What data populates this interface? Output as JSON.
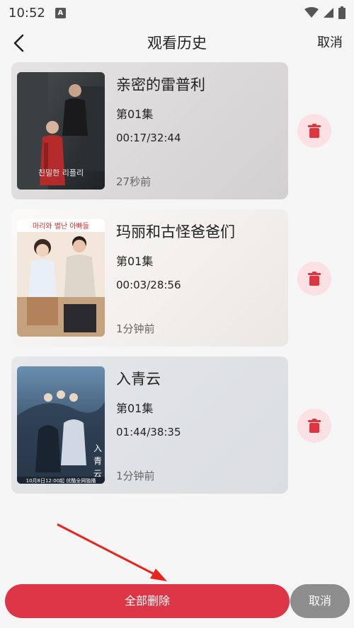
{
  "status_bar": {
    "time": "10:52",
    "notification_letter": "A",
    "icons": [
      "wifi-icon",
      "signal-icon",
      "battery-icon"
    ]
  },
  "header": {
    "title": "观看历史",
    "cancel_label": "取消",
    "back_icon": "chevron-left-icon"
  },
  "history": [
    {
      "title": "亲密的雷普利",
      "episode": "第01集",
      "progress": "00:17/32:44",
      "time_ago": "27秒前"
    },
    {
      "title": "玛丽和古怪爸爸们",
      "episode": "第01集",
      "progress": "00:03/28:56",
      "time_ago": "1分钟前"
    },
    {
      "title": "入青云",
      "episode": "第01集",
      "progress": "01:44/38:35",
      "time_ago": "1分钟前"
    }
  ],
  "poster_text": {
    "p1": "친밀한 리플리",
    "p2": "마리와 별난 아빠들",
    "p3": "10月8日12:00起 优酷全网独播"
  },
  "delete_icon": "trash-icon",
  "bottom": {
    "delete_all_label": "全部删除",
    "cancel_label": "取消"
  },
  "colors": {
    "accent": "#dc3545",
    "delete_bg": "#fbe1e4",
    "cancel_bg": "#8d8d8d"
  }
}
